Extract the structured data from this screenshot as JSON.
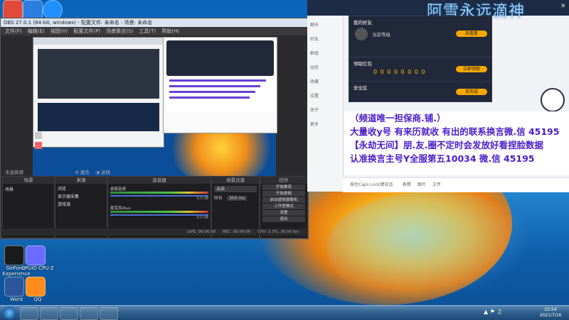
{
  "desktop": {
    "top_icons": [
      {
        "name": "app-icon-1",
        "color": "#e04a3a"
      },
      {
        "name": "app-icon-2",
        "color": "#2b7de0"
      },
      {
        "name": "app-icon-3",
        "color": "#1e90ff"
      }
    ],
    "left_icons": [
      {
        "label": "GeForce Experience",
        "color": "#1b1b1b"
      },
      {
        "label": "CPUID CPU-Z",
        "color": "#6b6bff"
      },
      {
        "label": "Word",
        "color": "#2b579a"
      },
      {
        "label": "QQ",
        "color": "#ff8c1a"
      }
    ]
  },
  "obs": {
    "title": "OBS 27.0.1 (64-bit, windows) - 配置文件: 未命名 - 场景: 未命名",
    "menu": [
      "文件(F)",
      "编辑(E)",
      "视图(V)",
      "配置文件(P)",
      "场景集合(S)",
      "工具(T)",
      "帮助(H)"
    ],
    "no_source": "未选择源",
    "properties_btn": "属性",
    "filters_btn": "滤镜",
    "panels": {
      "scenes": {
        "title": "场景",
        "items": [
          "场景"
        ]
      },
      "sources": {
        "title": "来源",
        "items": [
          "浏览",
          "显示器采集",
          "游戏源"
        ]
      },
      "mixer": {
        "title": "混音器",
        "tracks": [
          {
            "name": "桌面音频",
            "db": "0.0 dB"
          },
          {
            "name": "麦克风/Aux",
            "db": "0.0 dB"
          }
        ]
      },
      "transitions": {
        "title": "场景过渡",
        "type": "淡出",
        "duration_label": "时长",
        "duration": "300 ms"
      },
      "controls": {
        "title": "控件",
        "buttons": [
          "开始推流",
          "开始录制",
          "启动虚拟摄像机",
          "工作室模式",
          "设置",
          "退出"
        ]
      }
    },
    "status": {
      "live": "LIVE: 00:00:00",
      "rec": "REC: 00:00:00",
      "cpu": "CPU: 2.3%, 30.00 fps"
    }
  },
  "chat": {
    "watermark": "阿雪永远滴神",
    "cards": [
      {
        "title": "我的好友",
        "desc": "当前等级",
        "btn": "去看看",
        "digits": ""
      },
      {
        "title": "领取红包",
        "desc": "",
        "btn": "立即领取",
        "digits": "0 0 0 0 0 0 0 0"
      },
      {
        "title": "安全区",
        "desc": "",
        "btn": "去完成",
        "digits": ""
      }
    ],
    "sidebar_items": [
      "聊天",
      "好友",
      "群组",
      "动态",
      "收藏",
      "设置",
      "关于",
      "更多"
    ],
    "messages": [
      "（频道唯一担保商.铺.）",
      "大量收y号 有来历就收 有出的联系换言微.信 45195",
      "【永劫无间】朋.友.圈不定时会发放好看捏脸数据",
      "认准换言主号Y全服第五10034 微.信 45195"
    ],
    "input_hint": "按住Caps Lock键说话",
    "toolbar": [
      "表情",
      "图片",
      "文件"
    ]
  },
  "taskbar": {
    "time": "23:54",
    "date": "2021/7/16"
  }
}
